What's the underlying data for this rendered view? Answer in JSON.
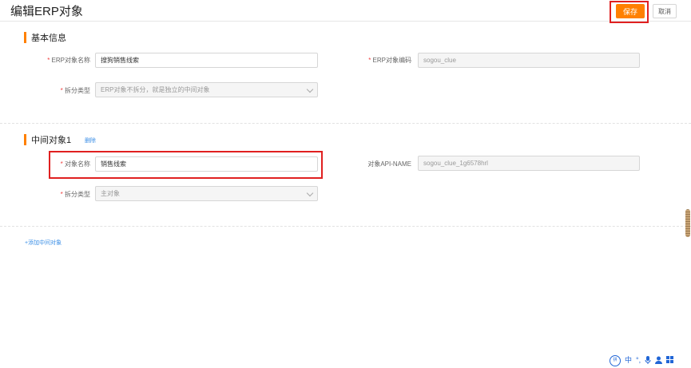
{
  "header": {
    "title": "编辑ERP对象",
    "save_label": "保存",
    "cancel_label": "取消"
  },
  "basic_info": {
    "title": "基本信息",
    "erp_name_label": "ERP对象名称",
    "erp_name_value": "搜狗销售线索",
    "erp_code_label": "ERP对象编码",
    "erp_code_value": "sogou_clue",
    "split_type_label": "拆分类型",
    "split_type_value": "ERP对象不拆分，就是独立的中间对象"
  },
  "intermediate": {
    "title": "中间对象1",
    "delete_label": "删除",
    "object_name_label": "对象名称",
    "object_name_value": "销售线索",
    "api_name_label": "对象API-NAME",
    "api_name_value": "sogou_clue_1g6578hrl",
    "split_type_label": "拆分类型",
    "split_type_value": "主对象"
  },
  "add_intermediate_label": "+添加中间对象",
  "required_mark": "*",
  "ime_toolbar": {
    "logo": "拼",
    "lang": "中",
    "icons": [
      "punctuation-icon",
      "mic-icon",
      "user-icon",
      "apps-icon"
    ]
  },
  "colors": {
    "accent": "#ff8000",
    "link": "#3a8ee6",
    "highlight": "#e02020",
    "required": "#f04040"
  }
}
